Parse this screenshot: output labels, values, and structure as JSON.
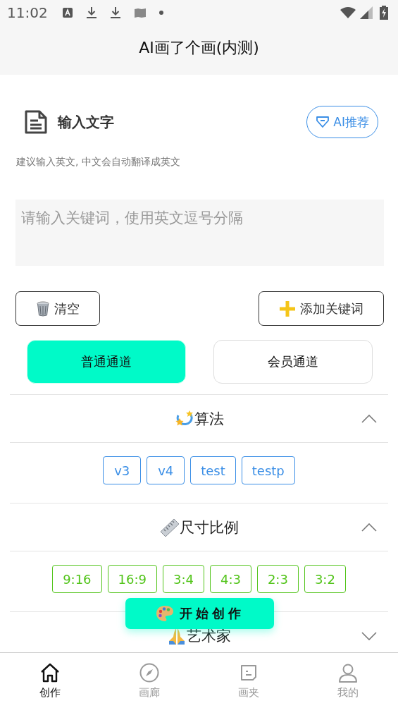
{
  "status_bar": {
    "time": "11:02"
  },
  "header": {
    "title": "AI画了个画(内测)"
  },
  "input_section": {
    "title": "输入文字",
    "recommend_button": "AI推荐",
    "hint": "建议输入英文, 中文会自动翻译成英文",
    "placeholder": "请输入关键词，使用英文逗号分隔"
  },
  "actions": [
    {
      "label": "清空",
      "kind": "trash"
    },
    {
      "label": "添加关键词",
      "kind": "plus"
    }
  ],
  "channels": [
    {
      "label": "普通通道",
      "selected": true
    },
    {
      "label": "会员通道",
      "selected": false
    }
  ],
  "sections": [
    {
      "title": "算法",
      "kind": "sparkle",
      "expanded": true,
      "color": "#3a8ee6",
      "options": [
        "v3",
        "v4",
        "test",
        "testp"
      ]
    },
    {
      "title": "尺寸比例",
      "kind": "ruler",
      "expanded": true,
      "color": "#52c41a",
      "options": [
        "9:16",
        "16:9",
        "3:4",
        "4:3",
        "2:3",
        "3:2"
      ]
    },
    {
      "title": "艺术家",
      "kind": "hands",
      "expanded": false
    }
  ],
  "start_button": "开始创作",
  "nav": [
    {
      "label": "创作",
      "kind": "home",
      "selected": true
    },
    {
      "label": "画廊",
      "kind": "compass",
      "selected": false
    },
    {
      "label": "画夹",
      "kind": "folder",
      "selected": false
    },
    {
      "label": "我的",
      "kind": "person",
      "selected": false
    }
  ]
}
